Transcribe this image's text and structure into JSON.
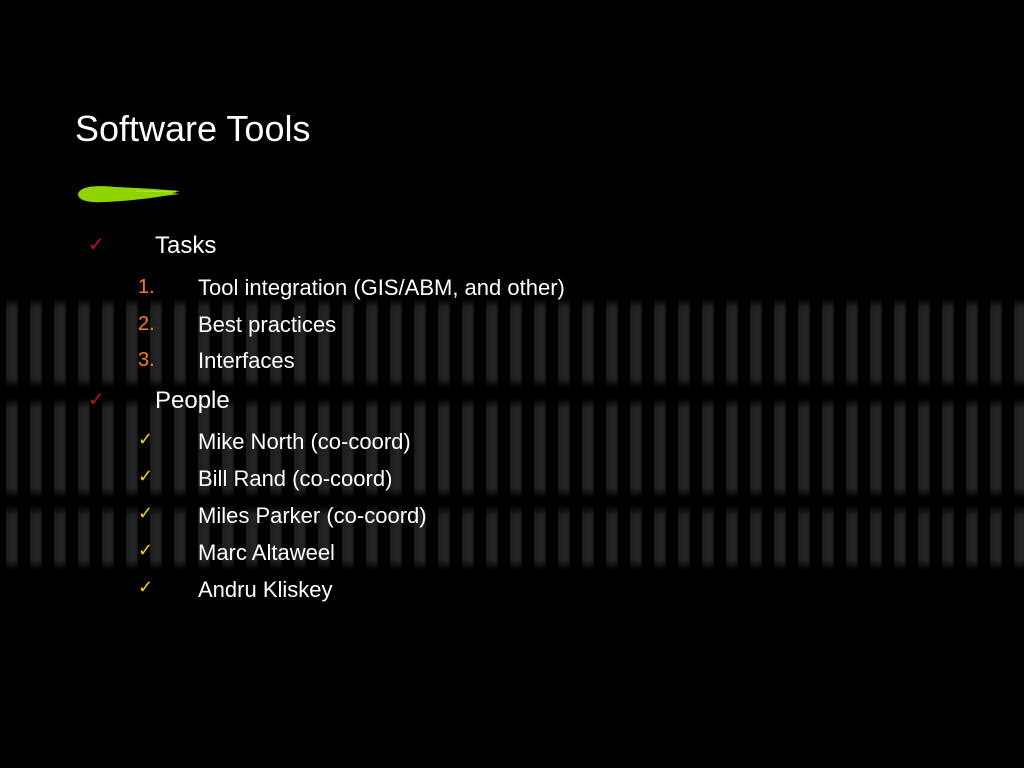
{
  "slide": {
    "title": "Software Tools",
    "colors": {
      "background": "#000000",
      "accent_brush": "#8fd400",
      "level1_bullet": "#c0111a",
      "level2_bullet": "#f2d200",
      "number": "#ff7a18",
      "text": "#ffffff"
    },
    "sections": [
      {
        "bullet_icon": "check-icon",
        "label": "Tasks",
        "items": [
          {
            "marker": "1.",
            "text": "Tool integration (GIS/ABM, and other)"
          },
          {
            "marker": "2.",
            "text": "Best practices"
          },
          {
            "marker": "3.",
            "text": "Interfaces"
          }
        ]
      },
      {
        "bullet_icon": "check-icon",
        "label": "People",
        "items": [
          {
            "marker": "✓",
            "text": "Mike North (co-coord)"
          },
          {
            "marker": "✓",
            "text": "Bill Rand (co-coord)"
          },
          {
            "marker": "✓",
            "text": "Miles Parker (co-coord)"
          },
          {
            "marker": "✓",
            "text": "Marc Altaweel"
          },
          {
            "marker": "✓",
            "text": "Andru Kliskey"
          }
        ]
      }
    ]
  }
}
